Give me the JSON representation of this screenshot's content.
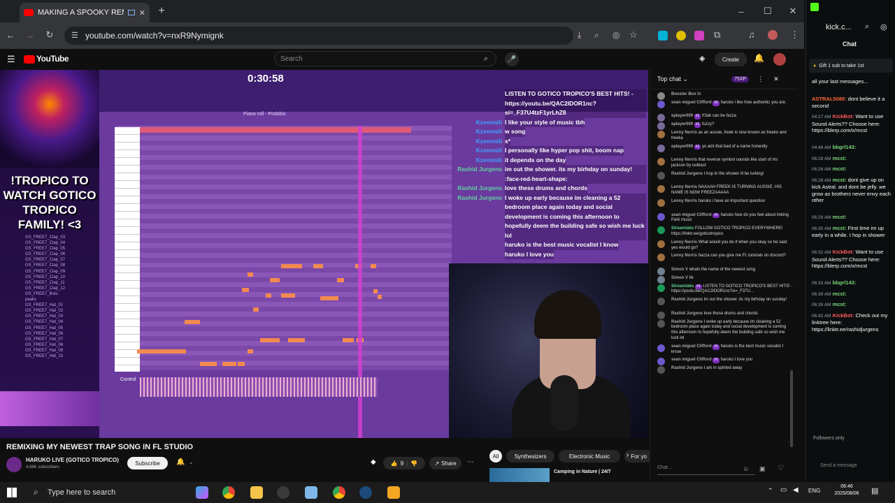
{
  "browser": {
    "tab_title": "MAKING A SPOOKY REMIX",
    "url": "youtube.com/watch?v=nxR9Nymignk",
    "new_tab": "+"
  },
  "youtube": {
    "logo": "YouTube",
    "search_placeholder": "Search",
    "create_label": "Create"
  },
  "video": {
    "promo_text": "!TROPICO TO WATCH GOTICO TROPICO FAMILY! <3",
    "timer": "0:30:58",
    "files": [
      "GS_FREE7_Clap_03",
      "GS_FREE7_Clap_04",
      "GS_FREE7_Clap_05",
      "GS_FREE7_Clap_06",
      "GS_FREE7_Clap_07",
      "GS_FREE7_Clap_08",
      "GS_FREE7_Clap_09",
      "GS_FREE7_Clap_10",
      "GS_FREE7_Clap_11",
      "GS_FREE7_Clap_12",
      "GS_FREE7_Buts",
      "peaks",
      "GS_FREE7_Hat_01",
      "GS_FREE7_Hat_02",
      "GS_FREE7_Hat_03",
      "GS_FREE7_Hat_04",
      "GS_FREE7_Hat_05",
      "GS_FREE7_Hat_06",
      "GS_FREE7_Hat_07",
      "GS_FREE7_Hat_08",
      "GS_FREE7_Hat_09",
      "GS_FREE7_Hat_10"
    ],
    "piano_roll_label": "Piano roll - Podobis",
    "control_label": "Control",
    "overlay_chat": [
      {
        "name": "",
        "text": "LISTEN TO GOTICO TROPICO'S BEST HITS! - https://youtu.be/QAC2IDOR1nc?si=_F37U4tzF1yrLhZ8"
      },
      {
        "name": "Kzemmili",
        "text": "I like your style of music tbh"
      },
      {
        "name": "Kzemmili",
        "text": "w song"
      },
      {
        "name": "Kzemmili",
        "text": "s*"
      },
      {
        "name": "Kzemmili",
        "text": "I personally like hyper pop shit, boom nap"
      },
      {
        "name": "Kzemmili",
        "text": "it depends on the day"
      },
      {
        "name": "Rashid Jurgens",
        "text": "im out the shower. its my birhday on sunday! :face-red-heart-shape:"
      },
      {
        "name": "Rashid Jurgens",
        "text": "love these drums and chords"
      },
      {
        "name": "Rashid Jurgens",
        "text": "I woke up early because im cleaning a 52 bedroom place again today and social development is coming this afternoon to hopefully deem the building safe so wish me luck lol"
      },
      {
        "name": "",
        "text": "haruko is the best music vocalist I know"
      },
      {
        "name": "",
        "text": "haruko I love you"
      }
    ]
  },
  "below": {
    "title": "REMIXING MY NEWEST TRAP SONG IN FL STUDIO",
    "channel": "HARUKO LIVE (GOTICO TROPICO)",
    "subscribers": "4.66K subscribers",
    "subscribe": "Subscribe",
    "likes": "9",
    "share": "Share",
    "chips": [
      "All",
      "Synthesizers",
      "Electronic Music",
      "For yo"
    ],
    "rec_title": "Camping in Nature | 24/7"
  },
  "ytchat": {
    "header": "Top chat",
    "points": "75XP",
    "input_placeholder": "Chat...",
    "messages": [
      {
        "name": "Booster Box",
        "text": "hi",
        "color": "#888"
      },
      {
        "name": "sean miguel Clifford",
        "badge": "#2",
        "text": "haruko i like how authentic you are.",
        "color": "#6a5acd"
      },
      {
        "name": "eplayer009",
        "badge": "#1",
        "text": "fr3ak can be fazza",
        "color": "#7a6a9a"
      },
      {
        "name": "eplayer009",
        "badge": "#1",
        "text": "fuzzy?",
        "color": "#7a6a9a"
      },
      {
        "name": "Lenny Norris",
        "text": "as an aussie, freek is now known as freeko and freeka",
        "color": "#a07040"
      },
      {
        "name": "eplayer009",
        "badge": "#1",
        "text": "yo aint that bad of a name honestly",
        "color": "#7a6a9a"
      },
      {
        "name": "Lenny Norris",
        "text": "that reverse symbol sounds like start of ms jackson by outkast",
        "color": "#a07040"
      },
      {
        "name": "Rashid Jurgens",
        "text": "I hop in the shower ill be lurking!",
        "color": "#555"
      },
      {
        "name": "Lenny Norris",
        "text": "NAAAAH FREEK IS TURNING AUSSIE, HIS NAME IS NOW FREEZAAAAA",
        "color": "#a07040"
      },
      {
        "name": "Lenny Norris",
        "text": "haruko i have an important question",
        "color": "#a07040"
      },
      {
        "name": "sean miguel Clifford",
        "badge": "#1",
        "text": "haruko how do you feel about linking Park music",
        "color": "#6a5acd"
      },
      {
        "name": "Streamlabs",
        "text": "FOLLOW GOTICO TROPICO EVERYWHERE! https://linktr.ee/goticotropico",
        "color": "#1a9a5a",
        "green": true
      },
      {
        "name": "Lenny Norris",
        "text": "What would you do if when you okay so he said yes would go?",
        "color": "#a07040"
      },
      {
        "name": "Lenny Norris",
        "text": "hazza can you give me FL tutorials on discord?",
        "color": "#a07040"
      },
      {
        "name": "Simon V",
        "text": "whats the name of the newest song",
        "color": "#708090"
      },
      {
        "name": "Simon V",
        "text": "kk",
        "color": "#708090"
      },
      {
        "name": "Streamlabs",
        "badge": "#2",
        "text": "LISTEN TO GOTICO TROPICO'S BEST HITS! - https://youtu.be/QAC2IDOR1nc?si=_F37U...",
        "color": "#1a9a5a",
        "green": true
      },
      {
        "name": "Rashid Jurgens",
        "text": "im out the shower. its my birhday on sunday!",
        "color": "#555"
      },
      {
        "name": "Rashid Jurgens",
        "text": "love these drums and chords",
        "color": "#555"
      },
      {
        "name": "Rashid Jurgens",
        "text": "I woke up early because im cleaning a 52 bedroom place again today and social development is coming this afternoon to hopefully deem the building safe so wish me luck lol",
        "color": "#555"
      },
      {
        "name": "sean miguel Clifford",
        "badge": "#1",
        "text": "haruko is the best music vocalist I know",
        "color": "#6a5acd"
      },
      {
        "name": "sean miguel Clifford",
        "badge": "#1",
        "text": "haruko I love you",
        "color": "#6a5acd"
      },
      {
        "name": "Rashid Jurgens",
        "text": "I am in spirited away",
        "color": "#555"
      }
    ]
  },
  "kick": {
    "site": "kick.c...",
    "chat_title": "Chat",
    "gift": "Gift 1 sub to take 1st",
    "messages": [
      {
        "time": "",
        "user": "",
        "color": "#fff",
        "text": "all your last messages..."
      },
      {
        "time": "",
        "user": "ASTRAL5080:",
        "color": "#ff6a3d",
        "text": "dont believe it a second"
      },
      {
        "time": "04:17 AM",
        "user": "KickBot:",
        "color": "#ff5a5a",
        "text": "Want to use Sound Alerts?? Choose here: https://blerp.com/x/mcst"
      },
      {
        "time": "04:48 AM",
        "user": "bbgrl143:",
        "color": "#7ad97a",
        "text": ""
      },
      {
        "time": "06:28 AM",
        "user": "mcst:",
        "color": "#7ad97a",
        "text": ""
      },
      {
        "time": "06:28 AM",
        "user": "mcst:",
        "color": "#7ad97a",
        "text": ""
      },
      {
        "time": "06:28 AM",
        "user": "mcst:",
        "color": "#7ad97a",
        "text": "dont give up on kick Astral. and dont be jelly. we grow as brothers never envy each other"
      },
      {
        "time": "06:29 AM",
        "user": "mcst:",
        "color": "#7ad97a",
        "text": ""
      },
      {
        "time": "06:30 AM",
        "user": "mcst:",
        "color": "#7ad97a",
        "text": "First time im up early in a while. I hop in shower"
      },
      {
        "time": "06:32 AM",
        "user": "KickBot:",
        "color": "#ff5a5a",
        "text": "Want to use Sound Alerts?? Choose here: https://blerp.com/x/mcst"
      },
      {
        "time": "06:33 AM",
        "user": "bbgrl143:",
        "color": "#7ad97a",
        "text": ""
      },
      {
        "time": "06:39 AM",
        "user": "mcst:",
        "color": "#7ad97a",
        "text": ""
      },
      {
        "time": "06:39 AM",
        "user": "mcst:",
        "color": "#7ad97a",
        "text": ""
      },
      {
        "time": "06:42 AM",
        "user": "KickBot:",
        "color": "#ff5a5a",
        "text": "Check out my linktree here: https://linktr.ee/rashidjurgens"
      }
    ],
    "followers_only": "Followers only",
    "send_placeholder": "Send a message"
  },
  "taskbar": {
    "search": "Type here to search",
    "lang": "ENG",
    "time": "06:46",
    "date": "2025/08/06"
  }
}
